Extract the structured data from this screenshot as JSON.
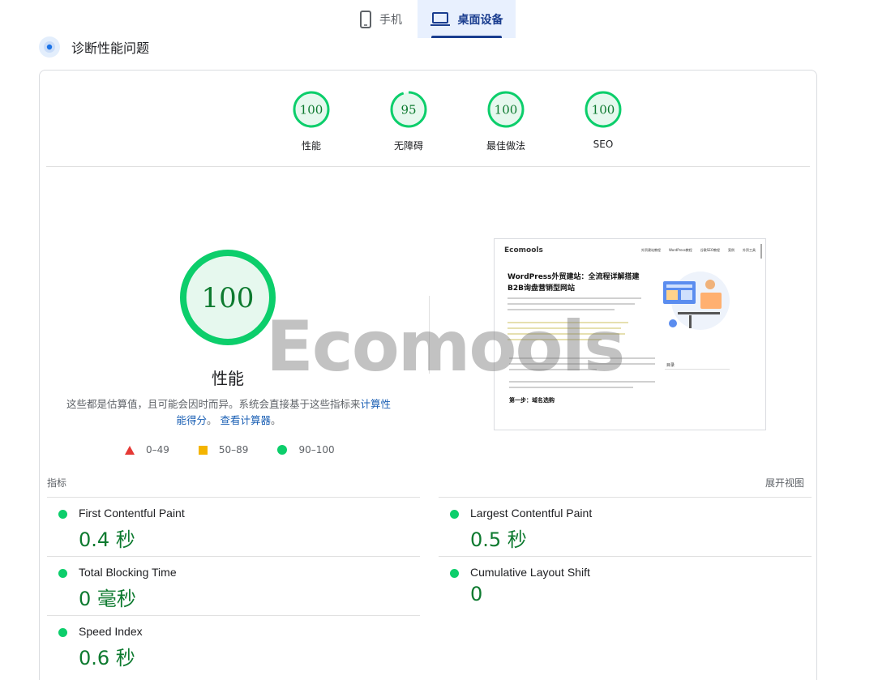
{
  "tabs": {
    "mobile_label": "手机",
    "desktop_label": "桌面设备"
  },
  "diagnostics": {
    "title": "诊断性能问题"
  },
  "gauges": [
    {
      "label": "性能",
      "score": "100",
      "fraction": 1.0
    },
    {
      "label": "无障碍",
      "score": "95",
      "fraction": 0.95
    },
    {
      "label": "最佳做法",
      "score": "100",
      "fraction": 1.0
    },
    {
      "label": "SEO",
      "score": "100",
      "fraction": 1.0
    }
  ],
  "performance": {
    "score": "100",
    "title": "性能",
    "note_prefix": "这些都是估算值，且可能会因时而异。系统会直接基于这些指标来",
    "note_link1": "计算性能得分",
    "note_middle": "。",
    "note_link2": "查看计算器",
    "note_suffix": "。"
  },
  "legend": {
    "fail": "0–49",
    "average": "50–89",
    "pass": "90–100"
  },
  "thumbnail": {
    "logo": "Ecomools",
    "nav": [
      "外贸建站教程",
      "WordPress教程",
      "谷歌SEO教程",
      "案例",
      "外贸工具"
    ],
    "headline": "WordPress外贸建站：全流程详解搭建B2B询盘营销型网站",
    "menu_label": "目录",
    "section_heading": "第一步：域名选购"
  },
  "watermark": "Ecomools",
  "metrics_header": {
    "left": "指标",
    "right": "展开视图"
  },
  "metrics": [
    {
      "name": "First Contentful Paint",
      "value": "0.4 秒"
    },
    {
      "name": "Largest Contentful Paint",
      "value": "0.5 秒"
    },
    {
      "name": "Total Blocking Time",
      "value": "0 毫秒"
    },
    {
      "name": "Cumulative Layout Shift",
      "value": "0"
    },
    {
      "name": "Speed Index",
      "value": "0.6 秒"
    }
  ],
  "colors": {
    "pass": "#0cce6b",
    "pass_text": "#0d7a2f",
    "pass_bg": "#e6f8ee",
    "accent": "#1a3d8f"
  }
}
